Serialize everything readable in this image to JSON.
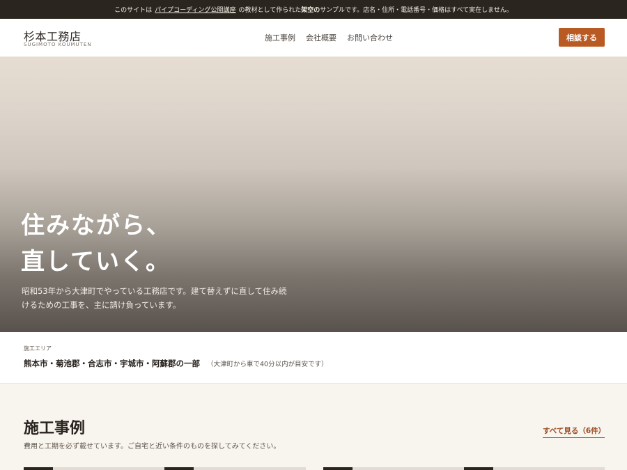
{
  "notice": {
    "prefix": "このサイトは",
    "link": "パイプコーディング公開講座",
    "middle": "の教材として作られた",
    "strong": "架空の",
    "suffix": "サンプルです。店名・住所・電話番号・価格はすべて実在しません。"
  },
  "header": {
    "logo_ja": "杉本工務店",
    "logo_en": "SUGIMOTO KOUMUTEN",
    "nav": [
      "施工事例",
      "会社概要",
      "お問い合わせ"
    ],
    "cta_label": "相談する"
  },
  "hero": {
    "title_line1": "住みながら、",
    "title_line2": "直していく。",
    "desc": "昭和53年から大津町でやっている工務店です。建て替えずに直して住み続けるための工事を、主に請け負っています。"
  },
  "service_area": {
    "label": "施工エリア",
    "areas": "熊本市・菊池郡・合志市・宇城市・阿蘇郡の一部",
    "note": "（大津町から車で40分以内が目安です）"
  },
  "works": {
    "title": "施工事例",
    "desc": "費用と工期を必ず載せています。ご自宅と近い条件のものを探してみてください。",
    "view_all": "すべて見る（6件）"
  },
  "colors": {
    "accent": "#b95a25",
    "dark": "#2b2520",
    "cream": "#f8f4ee"
  }
}
